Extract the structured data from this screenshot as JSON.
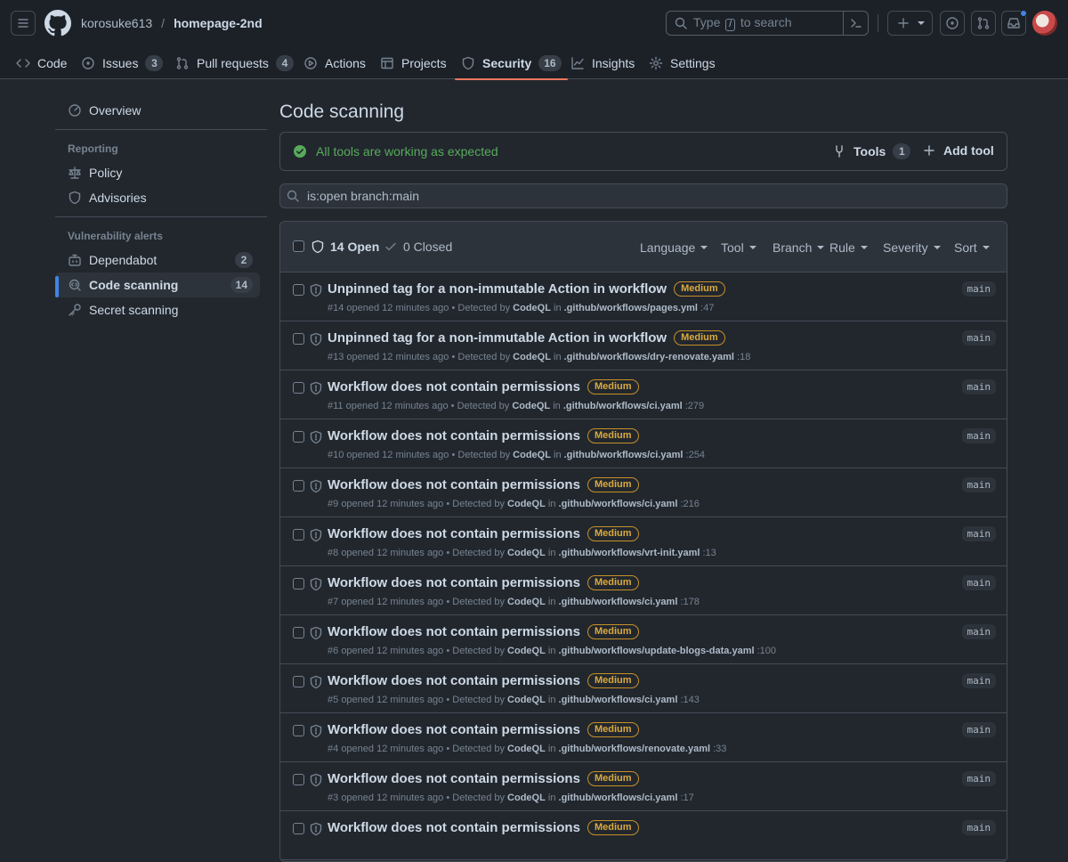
{
  "header": {
    "owner": "korosuke613",
    "separator": "/",
    "repo": "homepage-2nd",
    "search": {
      "prefix": "Type",
      "key": "/",
      "suffix": "to search"
    }
  },
  "tabs": [
    {
      "label": "Code",
      "icon": "code-icon"
    },
    {
      "label": "Issues",
      "count": "3",
      "icon": "issue-icon"
    },
    {
      "label": "Pull requests",
      "count": "4",
      "icon": "pull-request-icon"
    },
    {
      "label": "Actions",
      "icon": "play-icon"
    },
    {
      "label": "Projects",
      "icon": "table-icon"
    },
    {
      "label": "Security",
      "count": "16",
      "icon": "shield-icon",
      "active": true
    },
    {
      "label": "Insights",
      "icon": "graph-icon"
    },
    {
      "label": "Settings",
      "icon": "gear-icon"
    }
  ],
  "sidebar": {
    "overview": "Overview",
    "reporting_heading": "Reporting",
    "policy": "Policy",
    "advisories": "Advisories",
    "vuln_heading": "Vulnerability alerts",
    "dependabot": "Dependabot",
    "dependabot_count": "2",
    "code_scanning": "Code scanning",
    "code_scanning_count": "14",
    "secret_scanning": "Secret scanning"
  },
  "main": {
    "title": "Code scanning",
    "status": "All tools are working as expected",
    "tools_label": "Tools",
    "tools_count": "1",
    "add_tool": "Add tool",
    "filter_value": "is:open branch:main",
    "open_label": "14 Open",
    "closed_label": "0 Closed",
    "filters": [
      "Language",
      "Tool",
      "Branch",
      "Rule",
      "Severity",
      "Sort"
    ]
  },
  "alerts": [
    {
      "title": "Unpinned tag for a non-immutable Action in workflow",
      "severity": "Medium",
      "number": "#14",
      "file": ".github/workflows/pages.yml",
      "line": ":47",
      "branch": "main"
    },
    {
      "title": "Unpinned tag for a non-immutable Action in workflow",
      "severity": "Medium",
      "number": "#13",
      "file": ".github/workflows/dry-renovate.yaml",
      "line": ":18",
      "branch": "main"
    },
    {
      "title": "Workflow does not contain permissions",
      "severity": "Medium",
      "number": "#11",
      "file": ".github/workflows/ci.yaml",
      "line": ":279",
      "branch": "main"
    },
    {
      "title": "Workflow does not contain permissions",
      "severity": "Medium",
      "number": "#10",
      "file": ".github/workflows/ci.yaml",
      "line": ":254",
      "branch": "main"
    },
    {
      "title": "Workflow does not contain permissions",
      "severity": "Medium",
      "number": "#9",
      "file": ".github/workflows/ci.yaml",
      "line": ":216",
      "branch": "main"
    },
    {
      "title": "Workflow does not contain permissions",
      "severity": "Medium",
      "number": "#8",
      "file": ".github/workflows/vrt-init.yaml",
      "line": ":13",
      "branch": "main"
    },
    {
      "title": "Workflow does not contain permissions",
      "severity": "Medium",
      "number": "#7",
      "file": ".github/workflows/ci.yaml",
      "line": ":178",
      "branch": "main"
    },
    {
      "title": "Workflow does not contain permissions",
      "severity": "Medium",
      "number": "#6",
      "file": ".github/workflows/update-blogs-data.yaml",
      "line": ":100",
      "branch": "main"
    },
    {
      "title": "Workflow does not contain permissions",
      "severity": "Medium",
      "number": "#5",
      "file": ".github/workflows/ci.yaml",
      "line": ":143",
      "branch": "main"
    },
    {
      "title": "Workflow does not contain permissions",
      "severity": "Medium",
      "number": "#4",
      "file": ".github/workflows/renovate.yaml",
      "line": ":33",
      "branch": "main"
    },
    {
      "title": "Workflow does not contain permissions",
      "severity": "Medium",
      "number": "#3",
      "file": ".github/workflows/ci.yaml",
      "line": ":17",
      "branch": "main"
    },
    {
      "title": "Workflow does not contain permissions",
      "severity": "Medium",
      "number": "",
      "file": "",
      "line": "",
      "branch": "main"
    }
  ],
  "alert_meta": {
    "opened": "opened 12 minutes ago",
    "detected_by": "Detected by",
    "tool": "CodeQL",
    "in": "in",
    "bullet": "•"
  }
}
